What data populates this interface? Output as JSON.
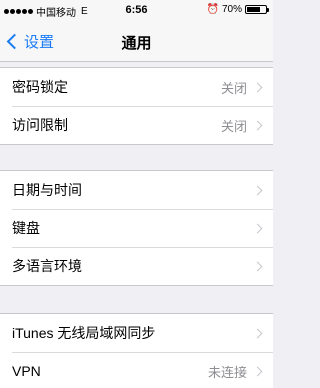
{
  "status_bar": {
    "carrier": "中国移动",
    "network": "E",
    "time": "6:56",
    "battery_text": "70%",
    "battery_level": 0.7
  },
  "nav": {
    "back_label": "设置",
    "title": "通用"
  },
  "groups": [
    {
      "rows": [
        {
          "label": "密码锁定",
          "value": "关闭"
        },
        {
          "label": "访问限制",
          "value": "关闭"
        }
      ]
    },
    {
      "rows": [
        {
          "label": "日期与时间",
          "value": ""
        },
        {
          "label": "键盘",
          "value": ""
        },
        {
          "label": "多语言环境",
          "value": ""
        }
      ]
    },
    {
      "rows": [
        {
          "label": "iTunes 无线局域网同步",
          "value": ""
        },
        {
          "label": "VPN",
          "value": "未连接"
        }
      ]
    }
  ]
}
